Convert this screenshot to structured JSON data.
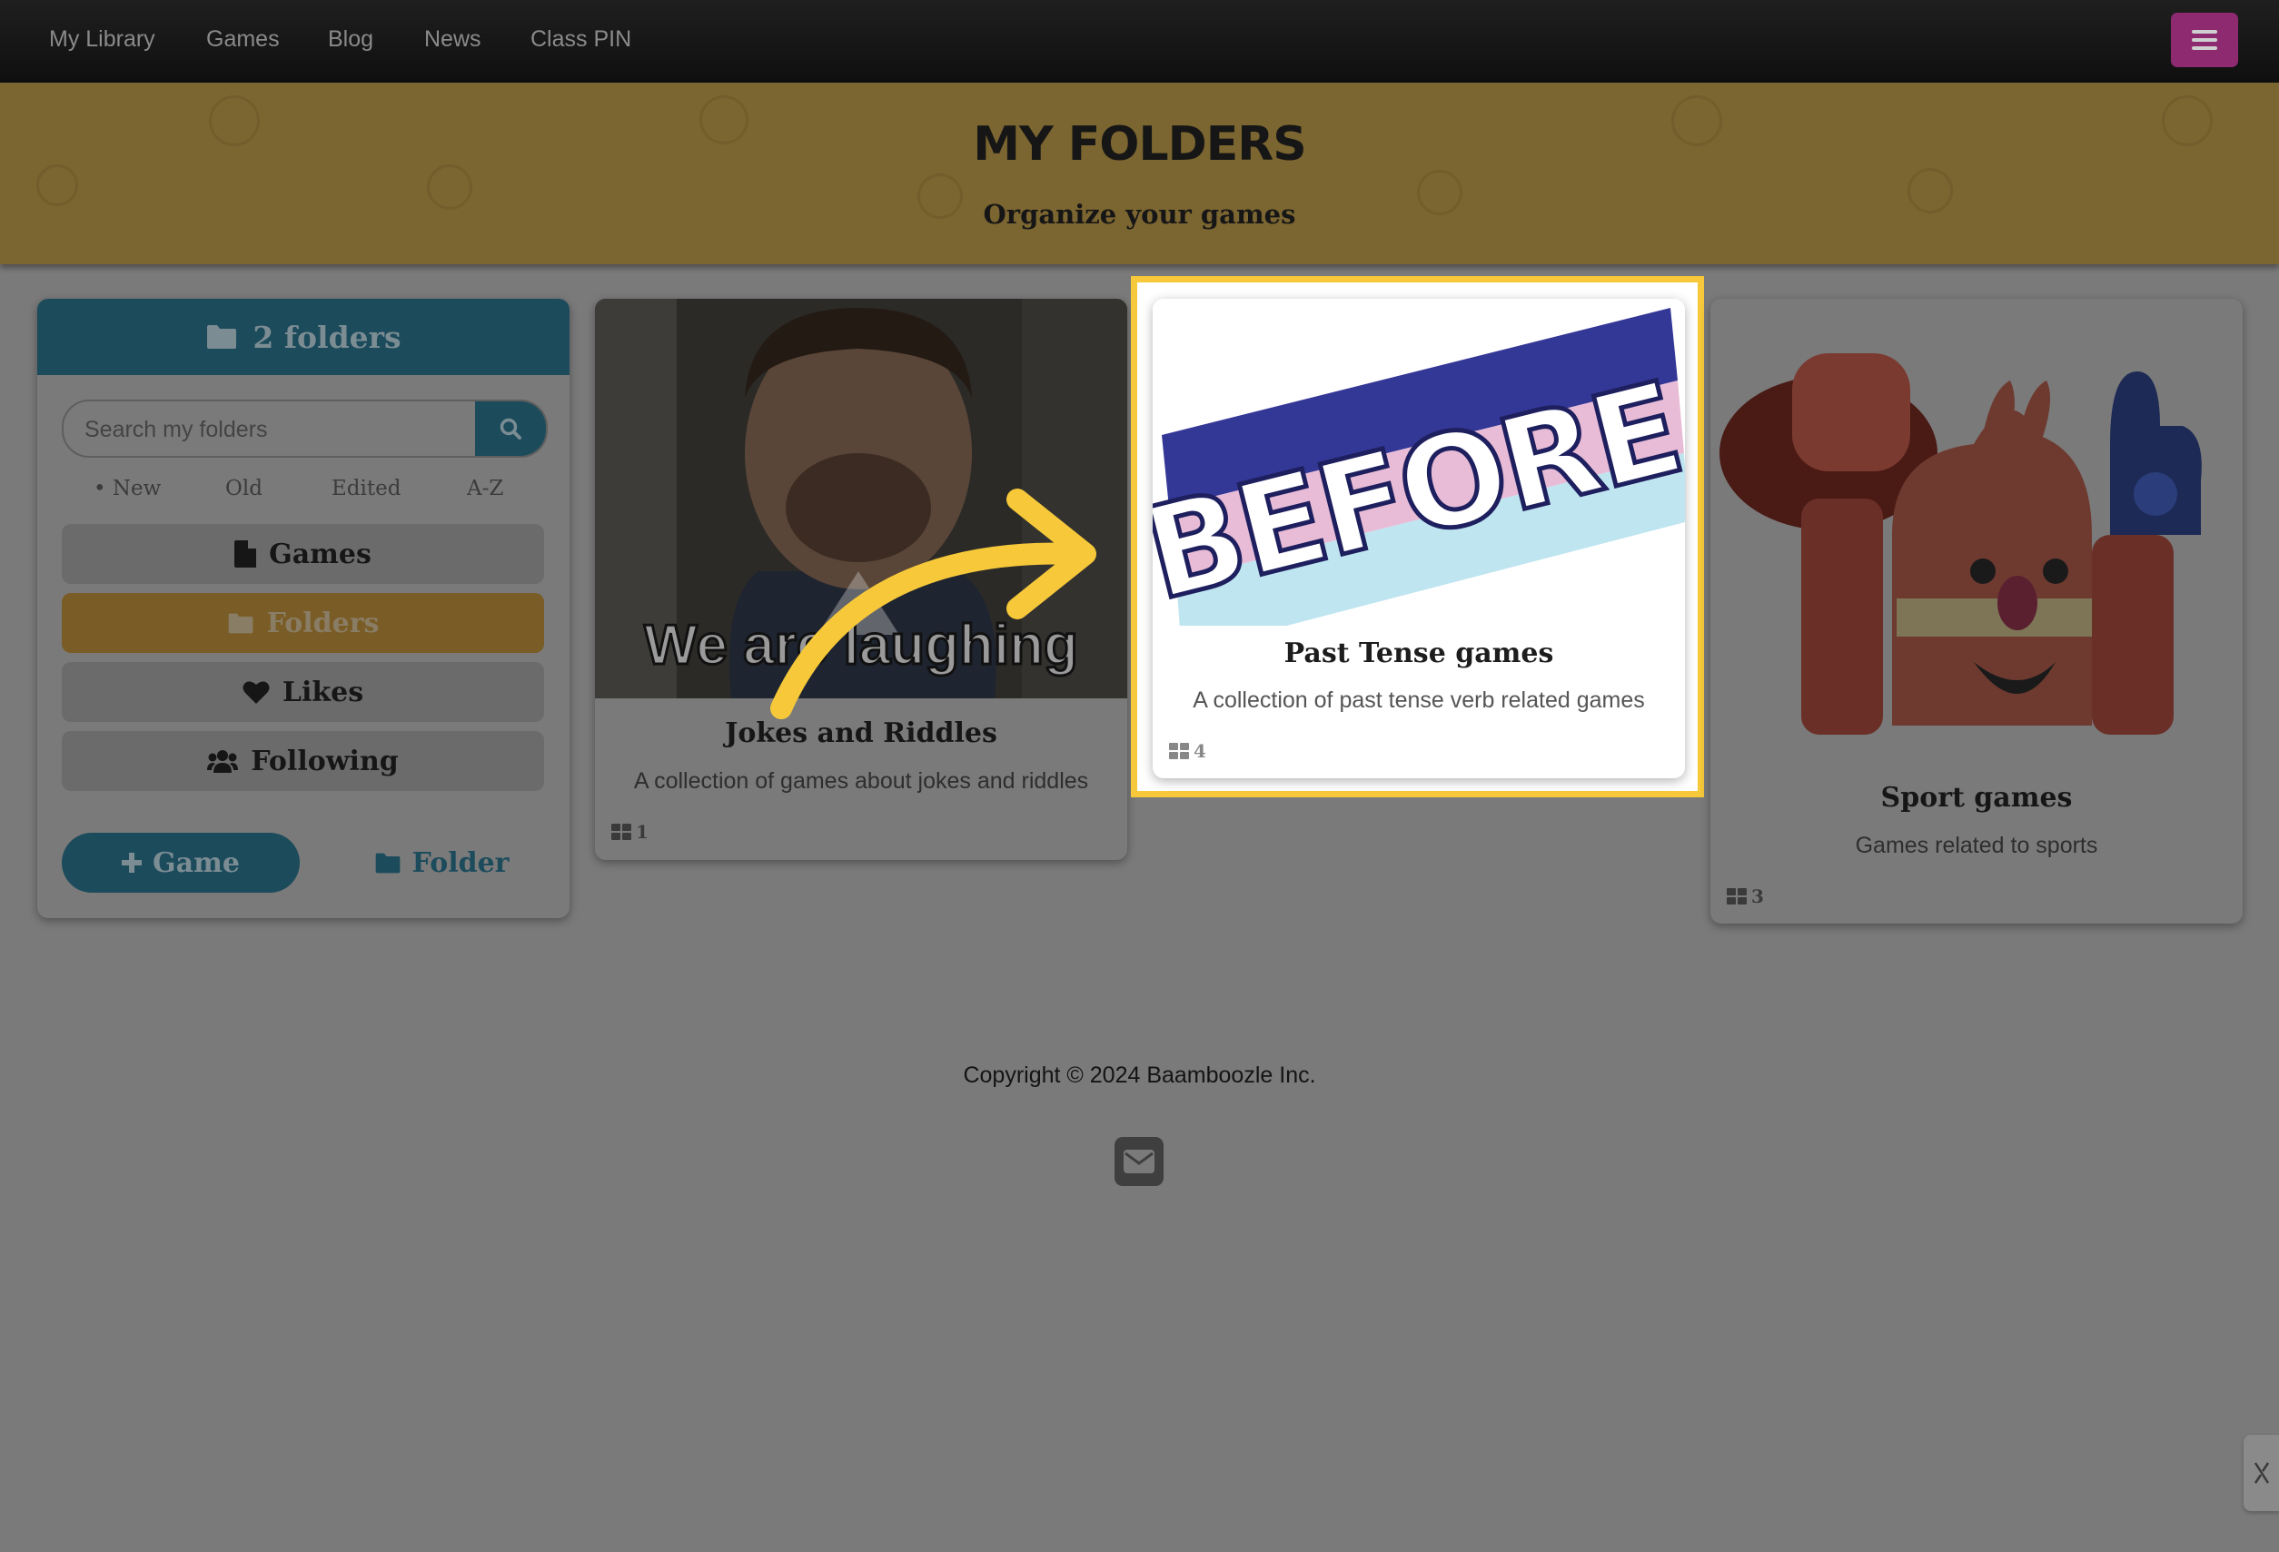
{
  "nav": {
    "links": [
      "My Library",
      "Games",
      "Blog",
      "News",
      "Class PIN"
    ]
  },
  "banner": {
    "title": "My Folders",
    "subtitle": "Organize your games"
  },
  "sidebar": {
    "header": "2 folders",
    "search_placeholder": "Search my folders",
    "sort_options": [
      "• New",
      "Old",
      "Edited",
      "A-Z"
    ],
    "items": [
      {
        "label": "Games",
        "icon": "file-icon"
      },
      {
        "label": "Folders",
        "icon": "folder-icon",
        "active": true
      },
      {
        "label": "Likes",
        "icon": "heart-icon"
      },
      {
        "label": "Following",
        "icon": "users-icon"
      }
    ],
    "add_game_label": "Game",
    "add_folder_label": "Folder"
  },
  "folders": [
    {
      "title": "Jokes and Riddles",
      "description": "A collection of games about jokes and riddles",
      "count": "1",
      "image_caption": "We are laughing"
    },
    {
      "title": "Past Tense games",
      "description": "A collection of past tense verb related games",
      "count": "4",
      "image_caption": "BEFORE",
      "highlighted": true
    },
    {
      "title": "Sport games",
      "description": "Games related to sports",
      "count": "3"
    }
  ],
  "footer": {
    "copyright": "Copyright © 2024 Baamboozle Inc."
  },
  "colors": {
    "overlay": "#7a7a7a",
    "teal": "#1c4b5c",
    "gold": "#7a5d26",
    "highlight": "#f6c83a",
    "menu": "#8e2a70",
    "arrow": "#f6c83a"
  }
}
